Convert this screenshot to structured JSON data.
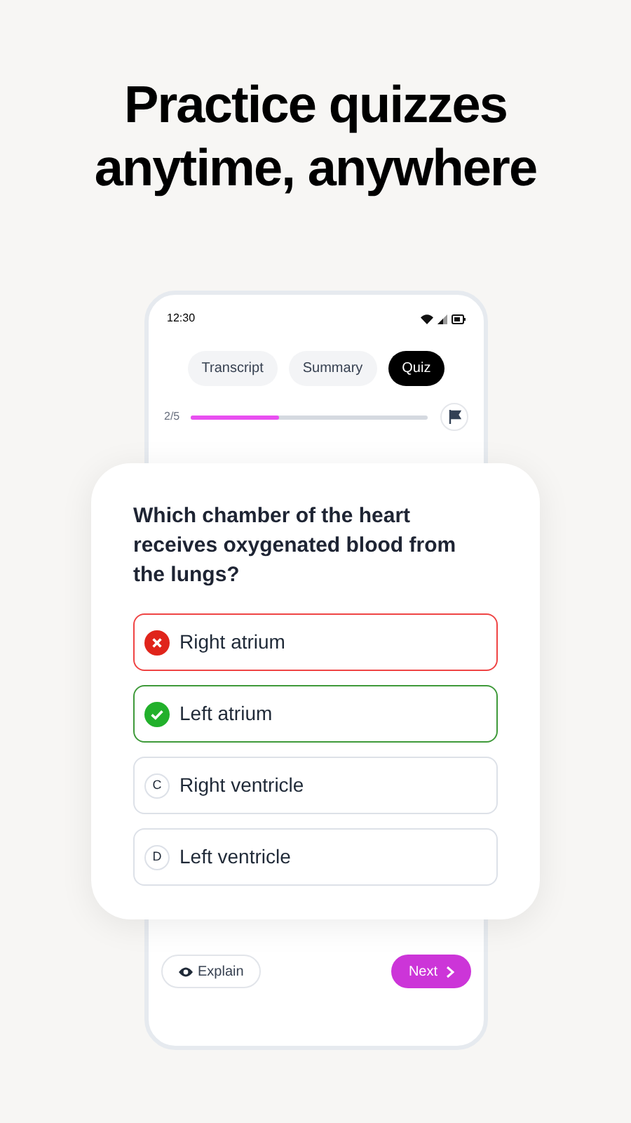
{
  "headline": "Practice quizzes anytime, anywhere",
  "status_bar": {
    "time": "12:30"
  },
  "tabs": [
    {
      "label": "Transcript",
      "selected": false
    },
    {
      "label": "Summary",
      "selected": false
    },
    {
      "label": "Quiz",
      "selected": true
    }
  ],
  "progress": {
    "counter": "2/5",
    "level": 0.37
  },
  "question": "Which chamber of the heart receives oxygenated blood from the lungs?",
  "options": [
    {
      "label": "Right atrium",
      "kind": "wrong"
    },
    {
      "label": "Left atrium",
      "kind": "correct"
    },
    {
      "label": "Right ventricle",
      "kind": "letter",
      "letter": "C"
    },
    {
      "label": "Left ventricle",
      "kind": "letter",
      "letter": "D"
    }
  ],
  "footer": {
    "explain": "Explain",
    "next": "Next"
  }
}
